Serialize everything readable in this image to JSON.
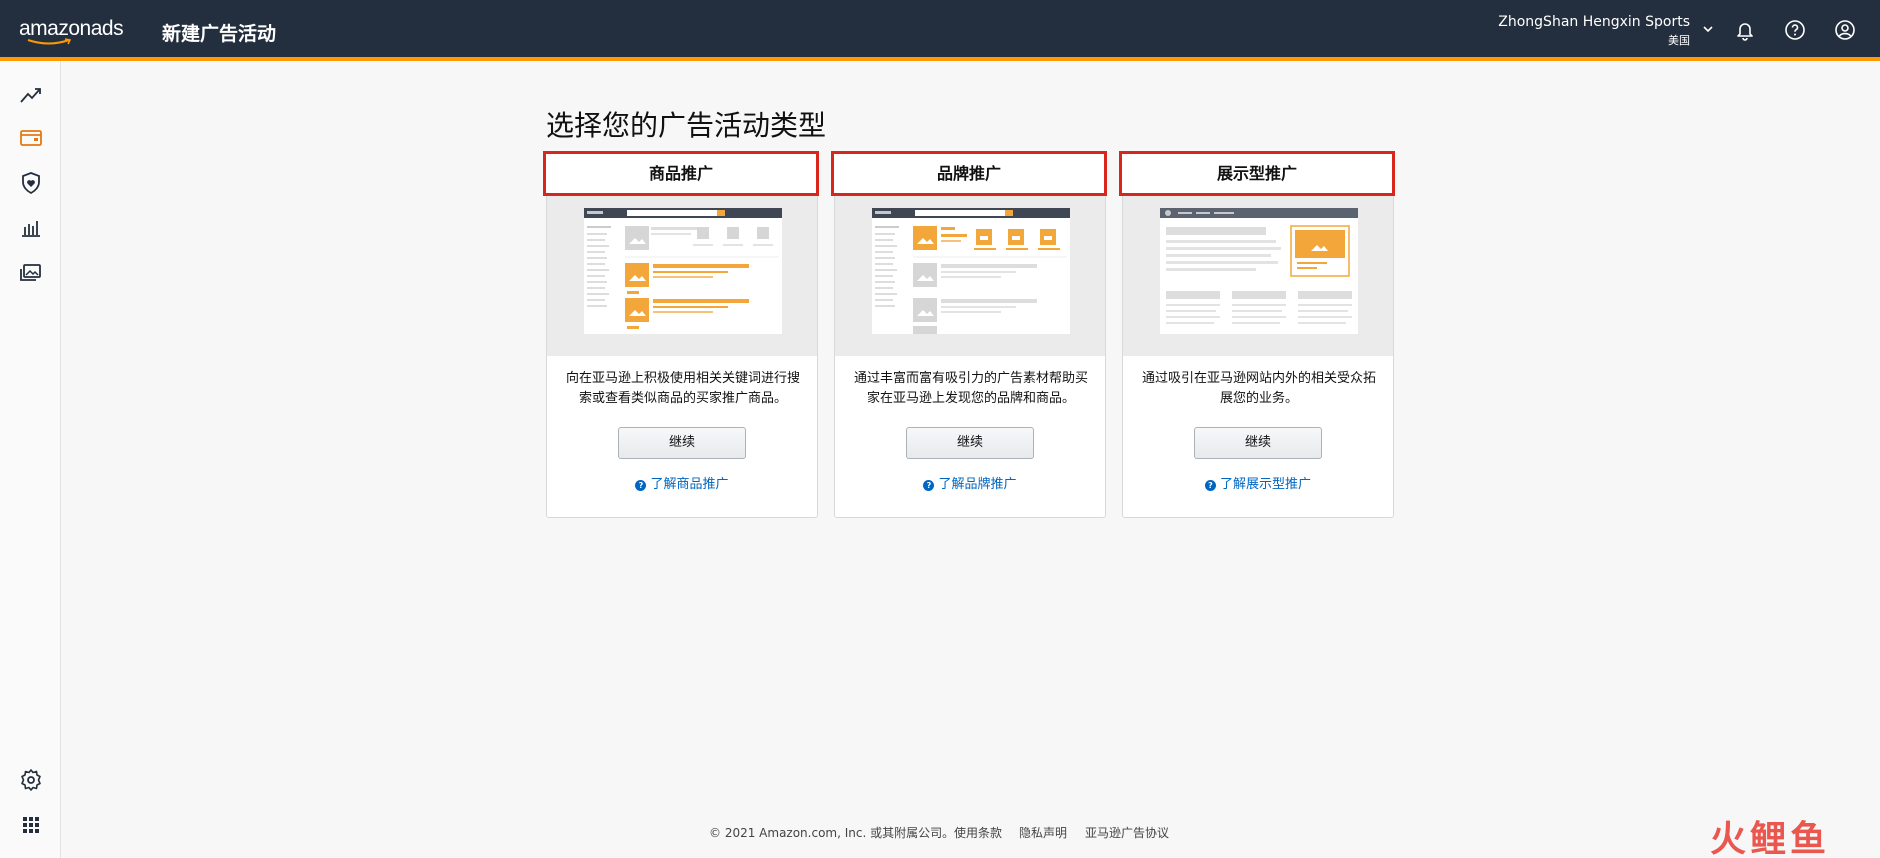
{
  "header": {
    "logo_text": "amazonads",
    "title": "新建广告活动",
    "account_name": "ZhongShan Hengxin Sports",
    "account_region": "美国",
    "icons": [
      "chevron-down-icon",
      "bell-icon",
      "help-icon",
      "user-icon"
    ]
  },
  "sidebar": {
    "items": [
      {
        "icon": "trend-chart-icon"
      },
      {
        "icon": "campaign-manager-icon",
        "active": true
      },
      {
        "icon": "brand-shield-icon"
      },
      {
        "icon": "bar-chart-icon"
      },
      {
        "icon": "media-library-icon"
      },
      {
        "icon": "settings-gear-icon"
      },
      {
        "icon": "apps-grid-icon"
      }
    ]
  },
  "main": {
    "page_title": "选择您的广告活动类型",
    "cards": [
      {
        "title": "商品推广",
        "description": "向在亚马逊上积极使用相关关键词进行搜索或查看类似商品的买家推广商品。",
        "button_label": "继续",
        "link_label": "了解商品推广"
      },
      {
        "title": "品牌推广",
        "description": "通过丰富而富有吸引力的广告素材帮助买家在亚马逊上发现您的品牌和商品。",
        "button_label": "继续",
        "link_label": "了解品牌推广"
      },
      {
        "title": "展示型推广",
        "description": "通过吸引在亚马逊网站内外的相关受众拓展您的业务。",
        "button_label": "继续",
        "link_label": "了解展示型推广"
      }
    ]
  },
  "footer": {
    "copyright": "© 2021 Amazon.com, Inc. 或其附属公司。",
    "links": [
      "使用条款",
      "隐私声明",
      "亚马逊广告协议"
    ]
  },
  "watermark": "火鲤鱼",
  "colors": {
    "topbar": "#232f3e",
    "accent": "#ff9900",
    "highlight_border": "#d7261b",
    "link": "#0066c0"
  }
}
